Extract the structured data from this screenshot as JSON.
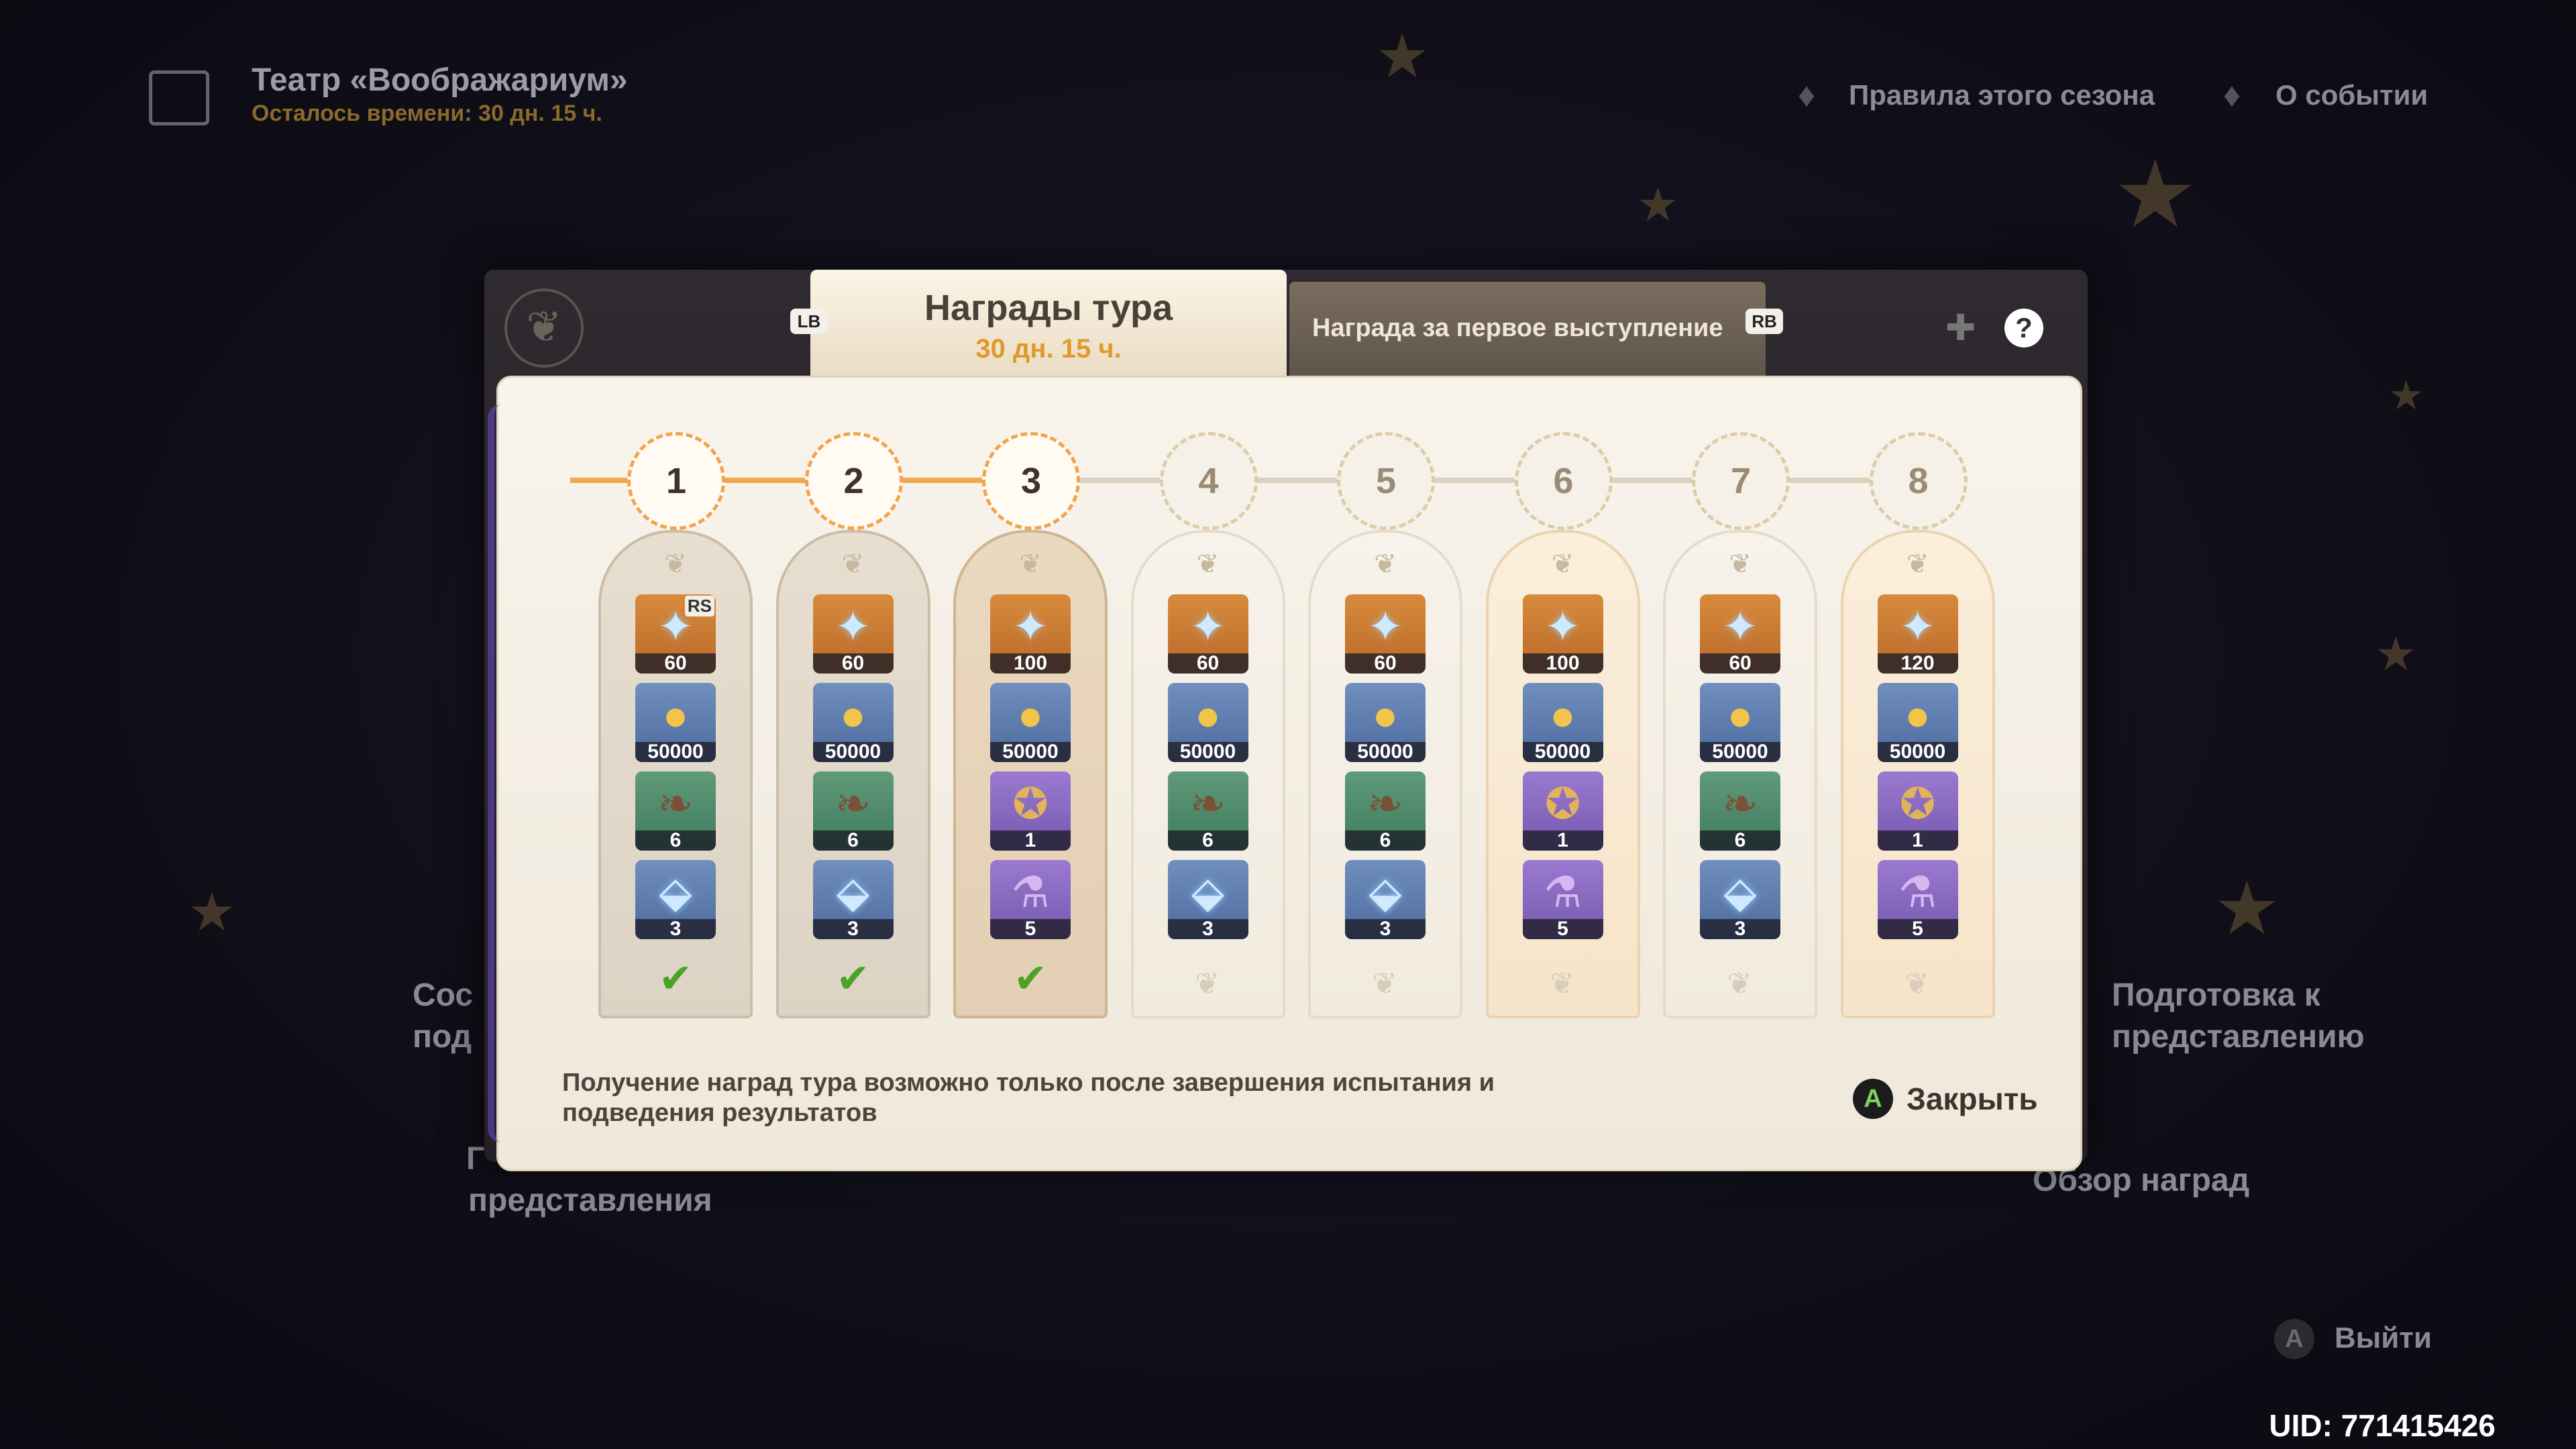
{
  "hud": {
    "title": "Театр «Воображариум»",
    "time_left": "Осталось времени: 30 дн. 15 ч.",
    "links": [
      "Правила этого сезона",
      "О событии"
    ],
    "bg_labels": [
      "Сос",
      "под",
      "Г",
      "представления",
      "Подготовка к",
      "представлению",
      "Обзор наград"
    ],
    "exit_button": "A",
    "exit_label": "Выйти",
    "uid": "UID: 771415426"
  },
  "modal": {
    "tab_active_title": "Награды тура",
    "tab_active_time": "30 дн. 15 ч.",
    "tab_inactive_title": "Награда за первое выступление",
    "bumper_left": "LB",
    "bumper_right": "RB",
    "help_symbol": "?",
    "footer_text": "Получение наград тура возможно только после завершения испытания и подведения результатов",
    "close_button": "A",
    "close_label": "Закрыть"
  },
  "tiers": [
    {
      "num": "1",
      "state": "claimed",
      "rewards": [
        {
          "icon": "primogem-icon",
          "qty": "60",
          "rarity": "orange",
          "badge": "RS"
        },
        {
          "icon": "mora-icon",
          "qty": "50000",
          "rarity": "blue"
        },
        {
          "icon": "talent-scroll-icon",
          "qty": "6",
          "rarity": "green"
        },
        {
          "icon": "weapon-ore-icon",
          "qty": "3",
          "rarity": "blue"
        }
      ]
    },
    {
      "num": "2",
      "state": "claimed",
      "rewards": [
        {
          "icon": "primogem-icon",
          "qty": "60",
          "rarity": "orange"
        },
        {
          "icon": "mora-icon",
          "qty": "50000",
          "rarity": "blue"
        },
        {
          "icon": "talent-scroll-icon",
          "qty": "6",
          "rarity": "green"
        },
        {
          "icon": "weapon-ore-icon",
          "qty": "3",
          "rarity": "blue"
        }
      ]
    },
    {
      "num": "3",
      "state": "claimed-highlight",
      "rewards": [
        {
          "icon": "primogem-icon",
          "qty": "100",
          "rarity": "orange"
        },
        {
          "icon": "mora-icon",
          "qty": "50000",
          "rarity": "blue"
        },
        {
          "icon": "medal-icon",
          "qty": "1",
          "rarity": "purple"
        },
        {
          "icon": "potion-icon",
          "qty": "5",
          "rarity": "purple"
        }
      ]
    },
    {
      "num": "4",
      "state": "open",
      "rewards": [
        {
          "icon": "primogem-icon",
          "qty": "60",
          "rarity": "orange"
        },
        {
          "icon": "mora-icon",
          "qty": "50000",
          "rarity": "blue"
        },
        {
          "icon": "talent-scroll-icon",
          "qty": "6",
          "rarity": "green"
        },
        {
          "icon": "weapon-ore-icon",
          "qty": "3",
          "rarity": "blue"
        }
      ]
    },
    {
      "num": "5",
      "state": "open",
      "rewards": [
        {
          "icon": "primogem-icon",
          "qty": "60",
          "rarity": "orange"
        },
        {
          "icon": "mora-icon",
          "qty": "50000",
          "rarity": "blue"
        },
        {
          "icon": "talent-scroll-icon",
          "qty": "6",
          "rarity": "green"
        },
        {
          "icon": "weapon-ore-icon",
          "qty": "3",
          "rarity": "blue"
        }
      ]
    },
    {
      "num": "6",
      "state": "gold",
      "rewards": [
        {
          "icon": "primogem-icon",
          "qty": "100",
          "rarity": "orange"
        },
        {
          "icon": "mora-icon",
          "qty": "50000",
          "rarity": "blue"
        },
        {
          "icon": "medal-icon",
          "qty": "1",
          "rarity": "purple"
        },
        {
          "icon": "potion-icon",
          "qty": "5",
          "rarity": "purple"
        }
      ]
    },
    {
      "num": "7",
      "state": "open",
      "rewards": [
        {
          "icon": "primogem-icon",
          "qty": "60",
          "rarity": "orange"
        },
        {
          "icon": "mora-icon",
          "qty": "50000",
          "rarity": "blue"
        },
        {
          "icon": "talent-scroll-icon",
          "qty": "6",
          "rarity": "green"
        },
        {
          "icon": "weapon-ore-icon",
          "qty": "3",
          "rarity": "blue"
        }
      ]
    },
    {
      "num": "8",
      "state": "gold",
      "rewards": [
        {
          "icon": "primogem-icon",
          "qty": "120",
          "rarity": "orange"
        },
        {
          "icon": "mora-icon",
          "qty": "50000",
          "rarity": "blue"
        },
        {
          "icon": "medal-icon",
          "qty": "1",
          "rarity": "purple"
        },
        {
          "icon": "potion-icon",
          "qty": "5",
          "rarity": "purple"
        }
      ]
    }
  ],
  "colors": {
    "accent_orange": "#e09a2c",
    "check_green": "#4aa324",
    "panel_bg": "#f8f4ec"
  }
}
